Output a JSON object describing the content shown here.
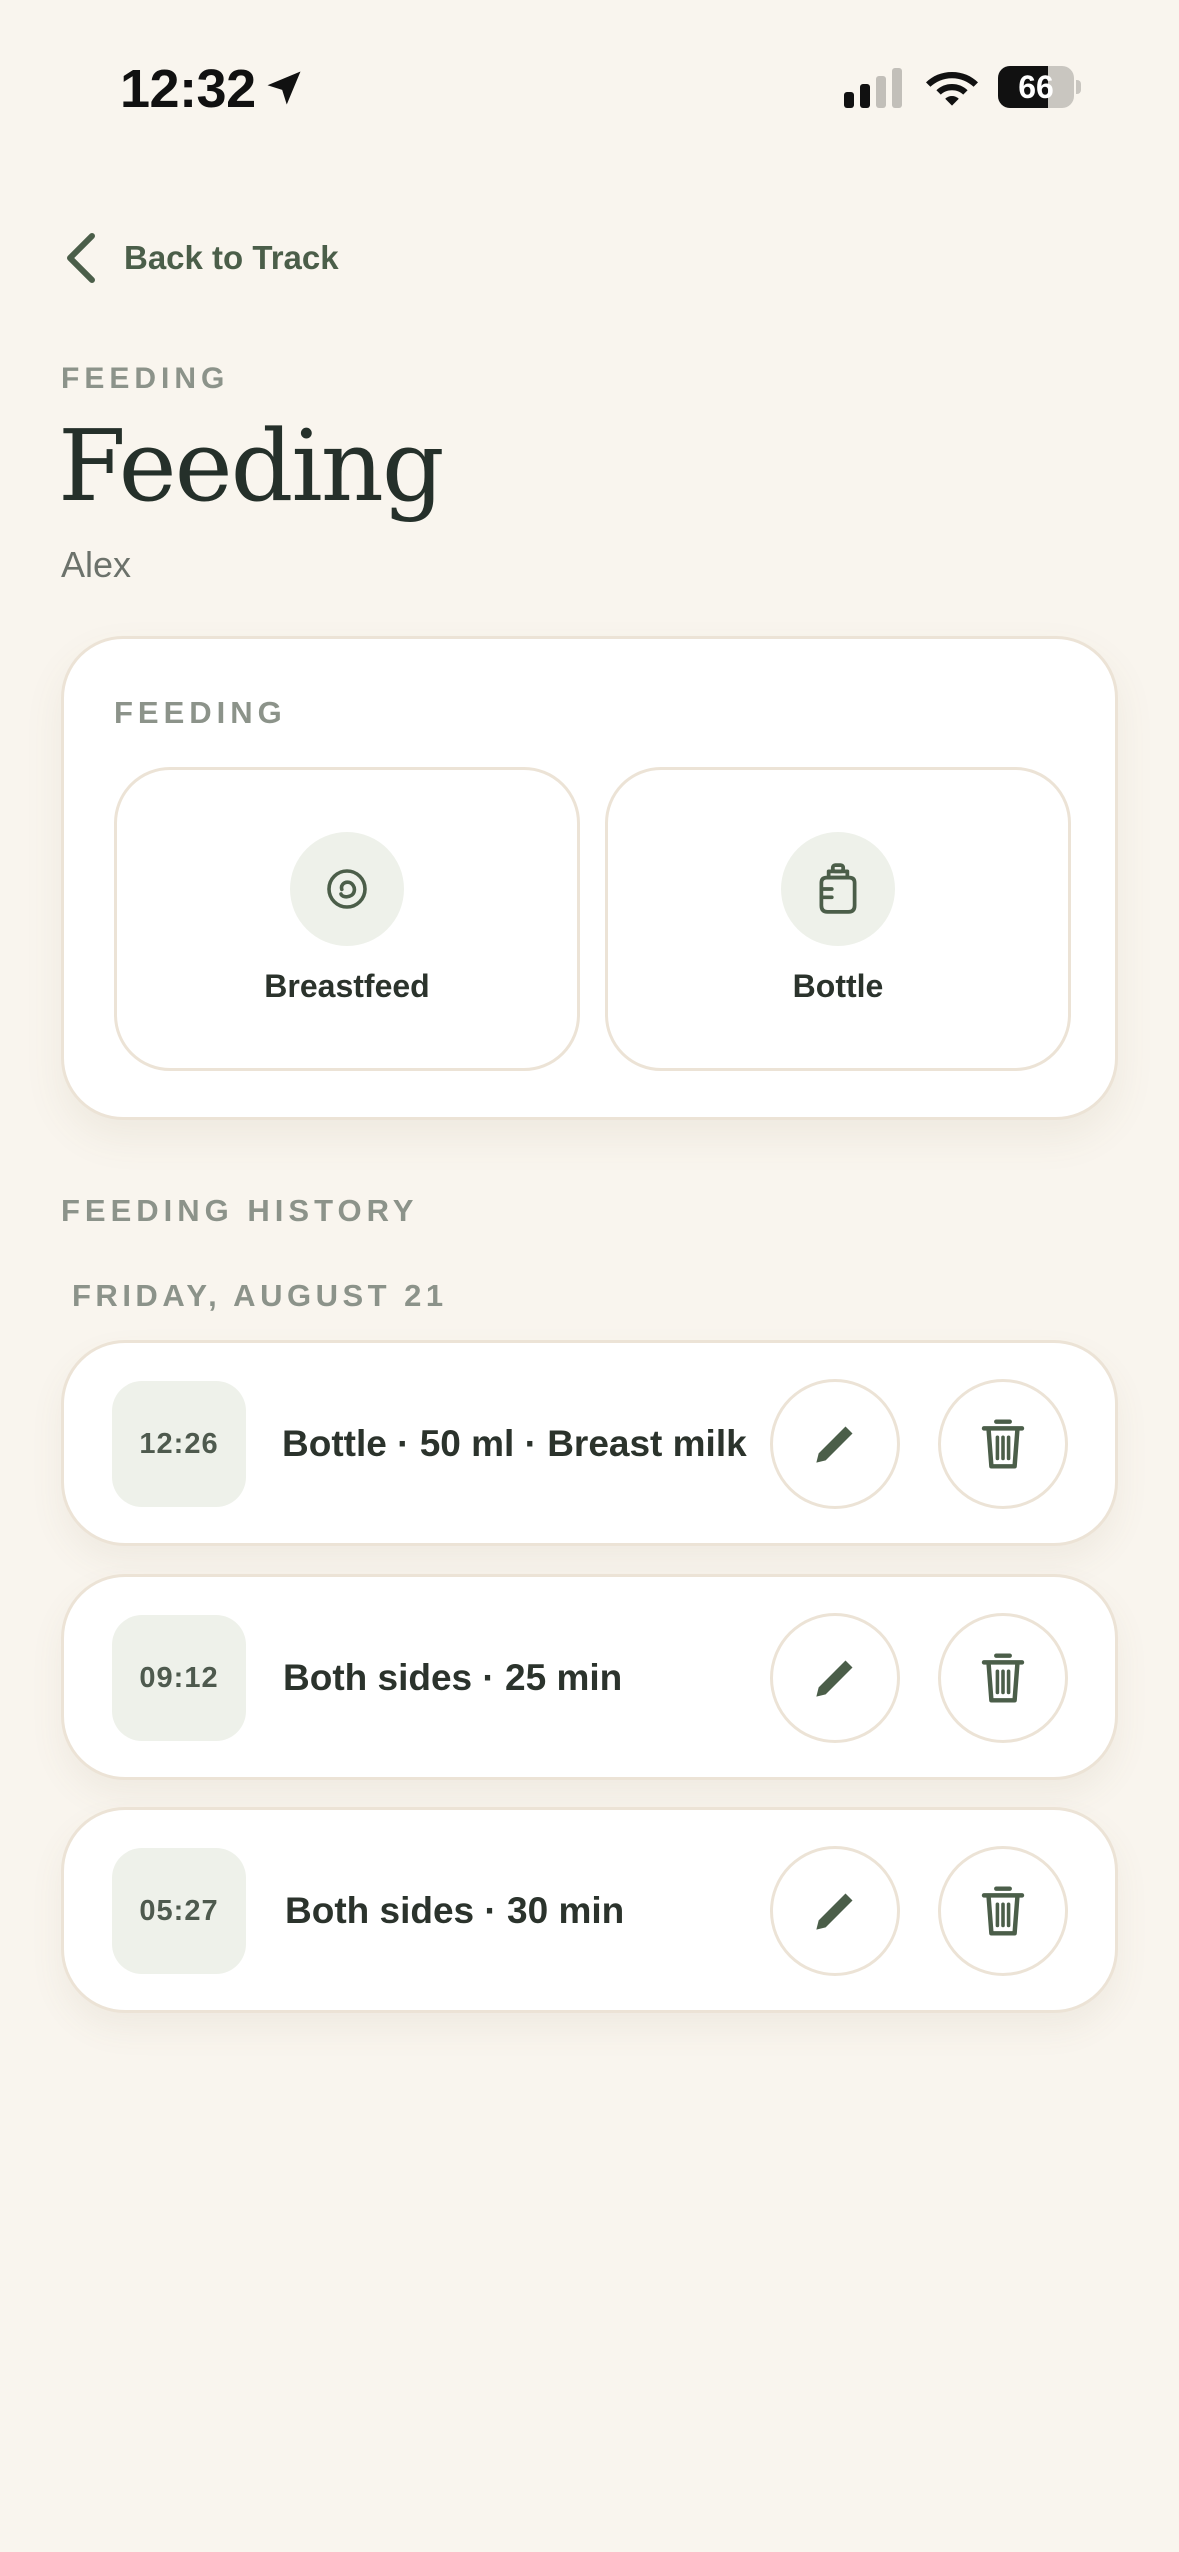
{
  "status_bar": {
    "time": "12:32",
    "battery_level": "66",
    "battery_fraction": 0.66
  },
  "header": {
    "back_label": "Back to Track",
    "eyebrow": "FEEDING",
    "title": "Feeding",
    "subtitle": "Alex"
  },
  "feeding_card": {
    "label": "FEEDING",
    "options": [
      {
        "label": "Breastfeed",
        "icon": "breastfeed-icon"
      },
      {
        "label": "Bottle",
        "icon": "bottle-icon"
      }
    ]
  },
  "history": {
    "label": "FEEDING HISTORY",
    "date": "FRIDAY, AUGUST 21",
    "entries": [
      {
        "time": "12:26",
        "text": "Bottle · 50 ml · Breast milk"
      },
      {
        "time": "09:12",
        "text": "Both sides · 25 min"
      },
      {
        "time": "05:27",
        "text": "Both sides · 30 min"
      }
    ]
  },
  "colors": {
    "background": "#f9f5ee",
    "accent": "#4b5e49",
    "muted": "#8c938a",
    "icon_bg": "#eef1ea",
    "border": "#ece3d6"
  },
  "icons": [
    "location-arrow-icon",
    "cellular-signal-icon",
    "wifi-icon",
    "battery-icon",
    "chevron-left-icon",
    "pencil-icon",
    "trash-icon"
  ]
}
